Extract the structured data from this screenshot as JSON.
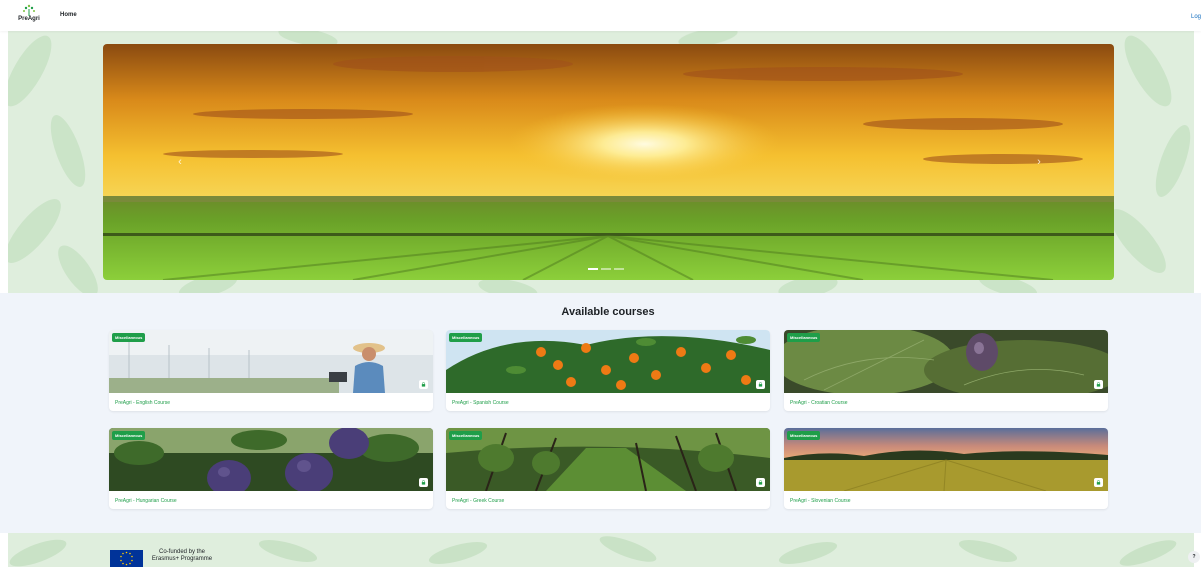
{
  "navbar": {
    "brand": "PreAgri",
    "home_label": "Home",
    "login_label": "Log"
  },
  "hero": {
    "prev_label": "‹",
    "next_label": "›",
    "slides": [
      {
        "active": true
      },
      {
        "active": false
      },
      {
        "active": false
      }
    ]
  },
  "courses": {
    "title": "Available courses",
    "items": [
      {
        "category": "Miscellaneous",
        "name": "PreAgri - English Course"
      },
      {
        "category": "Miscellaneous",
        "name": "PreAgri - Spanish Course"
      },
      {
        "category": "Miscellaneous",
        "name": "PreAgri - Croatian Course"
      },
      {
        "category": "Miscellaneous",
        "name": "PreAgri - Hungarian Course"
      },
      {
        "category": "Miscellaneous",
        "name": "PreAgri - Greek Course"
      },
      {
        "category": "Miscellaneous",
        "name": "PreAgri - Slovenian Course"
      }
    ]
  },
  "footer": {
    "cofunded_line1": "Co-funded by the",
    "cofunded_line2": "Erasmus+ Programme",
    "help_label": "?"
  },
  "colors": {
    "accent_green": "#1f9e49",
    "leaf_bg": "#dfeedd",
    "link_blue": "#0f6cbf"
  }
}
